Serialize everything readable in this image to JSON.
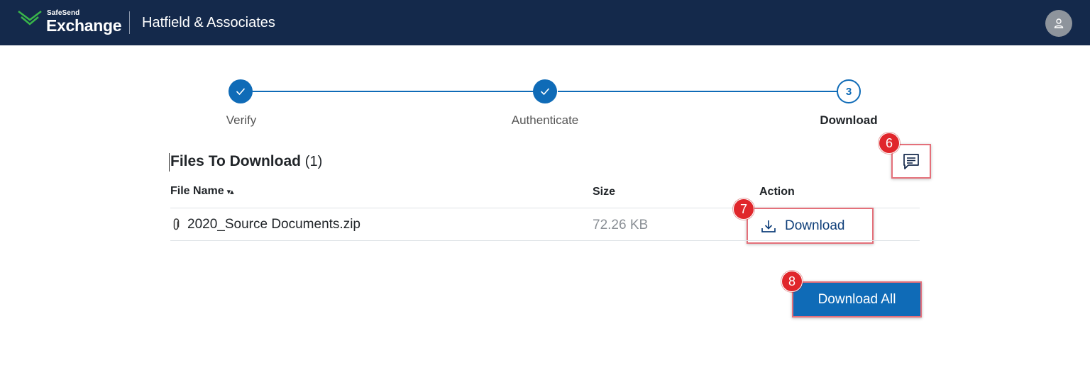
{
  "header": {
    "brand_small": "SafeSend",
    "brand_large": "Exchange",
    "company": "Hatfield & Associates",
    "avatar_icon": "user-icon"
  },
  "stepper": {
    "steps": [
      {
        "label": "Verify",
        "state": "complete"
      },
      {
        "label": "Authenticate",
        "state": "complete"
      },
      {
        "label": "Download",
        "state": "current",
        "number": "3"
      }
    ]
  },
  "files": {
    "title": "Files To Download",
    "count": "(1)",
    "columns": {
      "file_name": "File Name",
      "size": "Size",
      "action": "Action"
    },
    "sort_indicator": "▾▴",
    "rows": [
      {
        "name": "2020_Source Documents.zip",
        "size": "72.26 KB",
        "action_label": "Download"
      }
    ],
    "download_all_label": "Download All"
  },
  "callouts": {
    "message": "6",
    "download": "7",
    "download_all": "8"
  },
  "colors": {
    "header_bg": "#14294b",
    "primary": "#0f6bb7",
    "callout": "#e0262b",
    "highlight_border": "#e4707a"
  }
}
